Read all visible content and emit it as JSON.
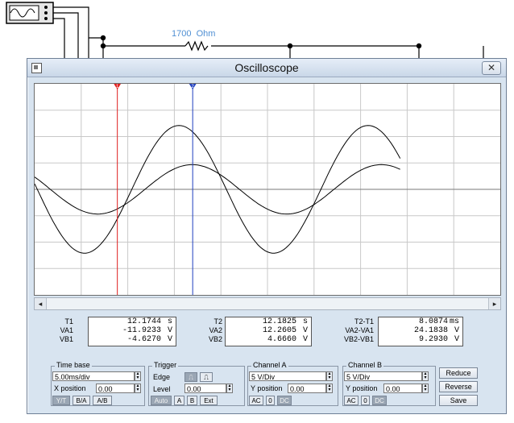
{
  "circuit": {
    "resistor_label": "1700  Ohm"
  },
  "window": {
    "title": "Oscilloscope",
    "close_glyph": "✕"
  },
  "cursors": {
    "t1_marker": "1",
    "t2_marker": "2"
  },
  "scrollbar": {
    "left_arrow": "◂",
    "right_arrow": "▸"
  },
  "readouts": {
    "cursor1": {
      "labels": [
        "T1",
        "VA1",
        "VB1"
      ],
      "values": [
        "12.1744",
        "-11.9233",
        "-4.6270"
      ],
      "units": [
        "s",
        "V",
        "V"
      ]
    },
    "cursor2": {
      "labels": [
        "T2",
        "VA2",
        "VB2"
      ],
      "values": [
        "12.1825",
        "12.2605",
        "4.6660"
      ],
      "units": [
        "s",
        "V",
        "V"
      ]
    },
    "diff": {
      "labels": [
        "T2-T1",
        "VA2-VA1",
        "VB2-VB1"
      ],
      "values": [
        "8.0874",
        "24.1838",
        "9.2930"
      ],
      "units": [
        "ms",
        "V",
        "V"
      ]
    }
  },
  "timebase": {
    "title": "Time base",
    "scale": "5.00ms/div",
    "xpos_label": "X position",
    "xpos_value": "0.00",
    "modes": [
      "Y/T",
      "B/A",
      "A/B"
    ],
    "active_mode": "Y/T"
  },
  "trigger": {
    "title": "Trigger",
    "edge_label": "Edge",
    "level_label": "Level",
    "level_value": "0.00",
    "modes": [
      "Auto",
      "A",
      "B",
      "Ext"
    ],
    "active_mode": "Auto"
  },
  "channel_a": {
    "title": "Channel A",
    "scale": "5  V/Div",
    "ypos_label": "Y position",
    "ypos_value": "0.00",
    "coupling": [
      "AC",
      "0",
      "DC"
    ],
    "active": "DC"
  },
  "channel_b": {
    "title": "Channel B",
    "scale": "5  V/Div",
    "ypos_label": "Y position",
    "ypos_value": "0.00",
    "coupling": [
      "AC",
      "0",
      "DC"
    ],
    "active": "DC"
  },
  "side_buttons": {
    "reduce": "Reduce",
    "reverse": "Reverse",
    "save": "Save"
  },
  "colors": {
    "cursor1": "#e02020",
    "cursor2": "#1f3fbf",
    "trace": "#000000",
    "grid": "#c8c8c8",
    "window_bg": "#d8e4f0"
  },
  "chart_data": {
    "type": "line",
    "title": "",
    "xlabel": "",
    "ylabel": "",
    "grid": true,
    "x_unit": "ms",
    "y_unit": "V",
    "x_range": [
      0,
      50
    ],
    "y_range": [
      -20,
      20
    ],
    "series": [
      {
        "period_ms": 20.3,
        "amplitude_v": 12.1,
        "phase_deg": 175
      },
      {
        "period_ms": 20.3,
        "amplitude_v": 4.68,
        "phase_deg": 150
      }
    ],
    "cursor_times_ms": [
      8.88,
      16.97
    ],
    "trace_end_ms": 39.4
  }
}
